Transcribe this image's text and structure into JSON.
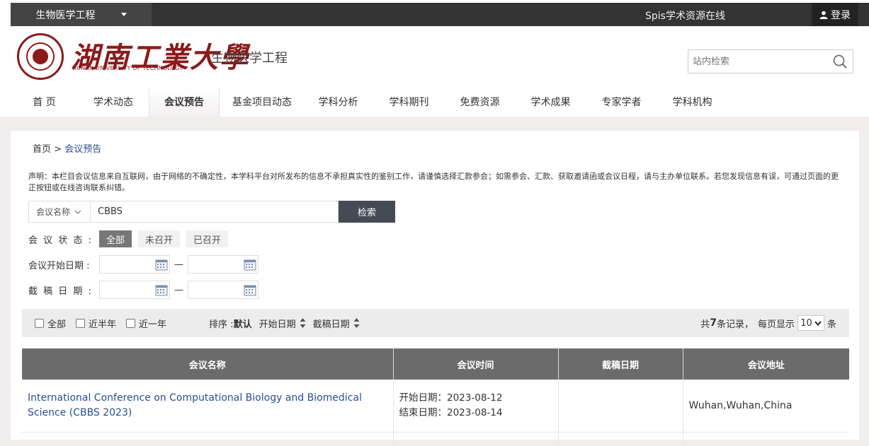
{
  "topbar": {
    "site_select": "生物医学工程",
    "platform": "Spis学术资源在线",
    "login": "登录"
  },
  "header": {
    "logo_cn": "湖南工業大學",
    "logo_en": "HUNAN UNIVERSITY OF TECHNOLOGY",
    "site_name": "生物医学工程",
    "search_placeholder": "站内检索"
  },
  "nav": [
    {
      "label": "首 页",
      "w": 95
    },
    {
      "label": "学术动态",
      "w": 100
    },
    {
      "label": "会议预告",
      "w": 100,
      "active": true
    },
    {
      "label": "基金项目动态",
      "w": 120
    },
    {
      "label": "学科分析",
      "w": 95
    },
    {
      "label": "学科期刊",
      "w": 105
    },
    {
      "label": "免费资源",
      "w": 95
    },
    {
      "label": "学术成果",
      "w": 105
    },
    {
      "label": "专家学者",
      "w": 95
    },
    {
      "label": "学科机构",
      "w": 105
    }
  ],
  "breadcrumb": {
    "home": "首页",
    "sep": " > ",
    "current": "会议预告"
  },
  "notice": "声明：本栏目会议信息来自互联网，由于网络的不确定性，本学科平台对所发布的信息不承担真实性的鉴别工作，请谨慎选择汇款参会；如需参会、汇款、获取邀请函或会议日程，请与主办单位联系。若您发现信息有误，可通过页面的更正按钮或在线咨询联系纠错。",
  "search": {
    "field": "会议名称",
    "value": "CBBS",
    "button": "检索"
  },
  "status": {
    "label": "会 议 状 态 :",
    "options": [
      "全部",
      "未召开",
      "已召开"
    ]
  },
  "start_date_label": "会议开始日期 :",
  "deadline_label": "截 稿 日 期 :",
  "dash": "—",
  "filter": {
    "checks": [
      "全部",
      "近半年",
      "近一年"
    ],
    "sort_label": "排序 :",
    "sort_default": "默认",
    "sort_opts": [
      "开始日期",
      "截稿日期"
    ],
    "total_prefix": "共",
    "total": "7",
    "total_suffix": "条记录，",
    "per_page_prefix": "每页显示",
    "per_page": "10",
    "per_page_suffix": "条"
  },
  "table": {
    "headers": [
      "会议名称",
      "会议时间",
      "截稿日期",
      "会议地址"
    ],
    "rows": [
      {
        "name": "International Conference on Computational Biology and Biomedical Science (CBBS 2023)",
        "start": "开始日期：2023-08-12",
        "end": "结束日期：2023-08-14",
        "deadline": "",
        "address": "Wuhan,Wuhan,China"
      }
    ]
  }
}
